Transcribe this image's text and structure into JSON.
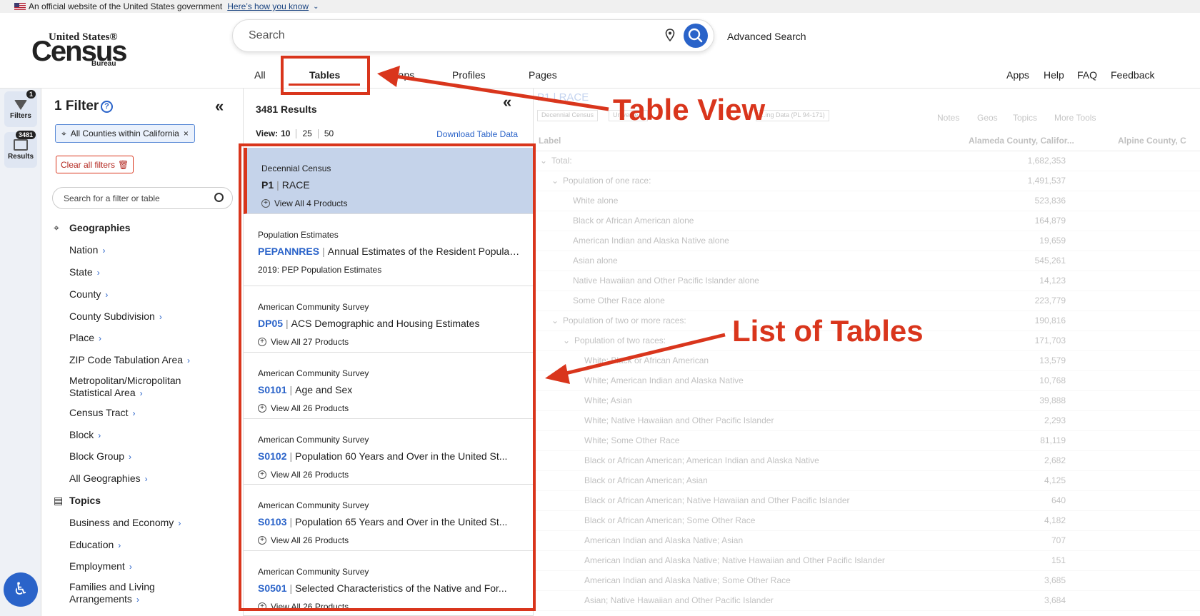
{
  "gov_banner": {
    "text": "An official website of the United States government",
    "link": "Here’s how you know"
  },
  "logo": {
    "line1": "United States®",
    "line2": "Census",
    "line3": "Bureau"
  },
  "search": {
    "placeholder": "Search",
    "advanced": "Advanced Search"
  },
  "nav": {
    "tabs": [
      "All",
      "Tables",
      "Maps",
      "Profiles",
      "Pages"
    ],
    "active": "Tables",
    "right": [
      "Apps",
      "Help",
      "FAQ",
      "Feedback"
    ]
  },
  "rail": {
    "filters_label": "Filters",
    "filters_badge": "1",
    "results_label": "Results",
    "results_badge": "3481",
    "accessibility_icon": "accessibility-icon"
  },
  "filters": {
    "title": "1 Filter",
    "chip": "All Counties within California",
    "clear": "Clear all filters",
    "search_placeholder": "Search for a filter or table",
    "geographies_heading": "Geographies",
    "geographies": [
      "Nation",
      "State",
      "County",
      "County Subdivision",
      "Place",
      "ZIP Code Tabulation Area",
      "Metropolitan/Micropolitan Statistical Area",
      "Census Tract",
      "Block",
      "Block Group",
      "All Geographies"
    ],
    "topics_heading": "Topics",
    "topics": [
      "Business and Economy",
      "Education",
      "Employment",
      "Families and Living Arrangements"
    ]
  },
  "results": {
    "count": "3481 Results",
    "view_label": "View:",
    "view_options": [
      "10",
      "25",
      "50"
    ],
    "download": "Download Table Data",
    "cards": [
      {
        "survey": "Decennial Census",
        "code": "P1",
        "title": "RACE",
        "sub": "View All 4 Products",
        "selected": true
      },
      {
        "survey": "Population Estimates",
        "code": "PEPANNRES",
        "title": "Annual Estimates of the Resident Population...",
        "sub": "2019: PEP Population Estimates"
      },
      {
        "survey": "American Community Survey",
        "code": "DP05",
        "title": "ACS Demographic and Housing Estimates",
        "sub": "View All 27 Products"
      },
      {
        "survey": "American Community Survey",
        "code": "S0101",
        "title": "Age and Sex",
        "sub": "View All 26 Products"
      },
      {
        "survey": "American Community Survey",
        "code": "S0102",
        "title": "Population 60 Years and Over in the United St...",
        "sub": "View All 26 Products"
      },
      {
        "survey": "American Community Survey",
        "code": "S0103",
        "title": "Population 65 Years and Over in the United St...",
        "sub": "View All 26 Products"
      },
      {
        "survey": "American Community Survey",
        "code": "S0501",
        "title": "Selected Characteristics of the Native and For...",
        "sub": "View All 26 Products"
      }
    ]
  },
  "table_view": {
    "title": "P1 | RACE",
    "tags": [
      "Decennial Census",
      "Universe...",
      "...ing Data (PL 94-171)"
    ],
    "tools": [
      "Notes",
      "Geos",
      "Topics",
      "More Tools"
    ],
    "columns": [
      "Label",
      "Alameda County, Califor...",
      "Alpine County, C"
    ],
    "rows": [
      {
        "label": "Total:",
        "value": "1,682,353",
        "level": 0,
        "expand": true
      },
      {
        "label": "Population of one race:",
        "value": "1,491,537",
        "level": 1,
        "expand": true
      },
      {
        "label": "White alone",
        "value": "523,836",
        "level": 2
      },
      {
        "label": "Black or African American alone",
        "value": "164,879",
        "level": 2
      },
      {
        "label": "American Indian and Alaska Native alone",
        "value": "19,659",
        "level": 2
      },
      {
        "label": "Asian alone",
        "value": "545,261",
        "level": 2
      },
      {
        "label": "Native Hawaiian and Other Pacific Islander alone",
        "value": "14,123",
        "level": 2
      },
      {
        "label": "Some Other Race alone",
        "value": "223,779",
        "level": 2
      },
      {
        "label": "Population of two or more races:",
        "value": "190,816",
        "level": 1,
        "expand": true
      },
      {
        "label": "Population of two races:",
        "value": "171,703",
        "level": 2,
        "expand": true
      },
      {
        "label": "White; Black or African American",
        "value": "13,579",
        "level": 3
      },
      {
        "label": "White; American Indian and Alaska Native",
        "value": "10,768",
        "level": 3
      },
      {
        "label": "White; Asian",
        "value": "39,888",
        "level": 3
      },
      {
        "label": "White; Native Hawaiian and Other Pacific Islander",
        "value": "2,293",
        "level": 3
      },
      {
        "label": "White; Some Other Race",
        "value": "81,119",
        "level": 3
      },
      {
        "label": "Black or African American; American Indian and Alaska Native",
        "value": "2,682",
        "level": 3
      },
      {
        "label": "Black or African American; Asian",
        "value": "4,125",
        "level": 3
      },
      {
        "label": "Black or African American; Native Hawaiian and Other Pacific Islander",
        "value": "640",
        "level": 3
      },
      {
        "label": "Black or African American; Some Other Race",
        "value": "4,182",
        "level": 3
      },
      {
        "label": "American Indian and Alaska Native; Asian",
        "value": "707",
        "level": 3
      },
      {
        "label": "American Indian and Alaska Native; Native Hawaiian and Other Pacific Islander",
        "value": "151",
        "level": 3
      },
      {
        "label": "American Indian and Alaska Native; Some Other Race",
        "value": "3,685",
        "level": 3
      },
      {
        "label": "Asian; Native Hawaiian and Other Pacific Islander",
        "value": "3,684",
        "level": 3
      }
    ]
  },
  "annotations": {
    "table_view": "Table View",
    "list_of_tables": "List of Tables",
    "color": "#d9351c"
  }
}
